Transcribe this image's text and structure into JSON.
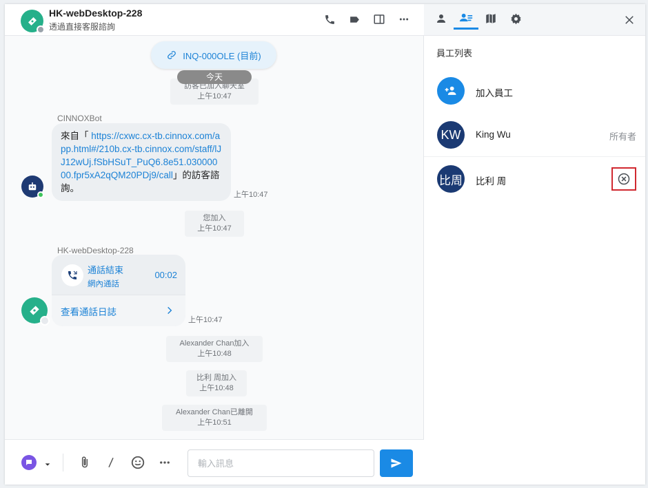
{
  "header": {
    "title": "HK-webDesktop-228",
    "subtitle": "透過直接客服諮詢"
  },
  "messages": {
    "inquiry_pill": "INQ-000OLE (目前)",
    "today": "今天",
    "sys1_line1": "訪客已加入聊天室",
    "sys1_line2": "上午10:47",
    "bot_sender": "CINNOXBot",
    "bot_prefix": "來自「 ",
    "bot_link": "https://cxwc.cx-tb.cinnox.com/app.html#/210b.cx-tb.cinnox.com/staff/lJJ12wUj.fSbHSuT_PuQ6.8e51.03000000.fpr5xA2qQM20PDj9/call",
    "bot_suffix": "」的訪客諮詢。",
    "bot_time": "上午10:47",
    "sys2_line1": "您加入",
    "sys2_line2": "上午10:47",
    "call_sender": "HK-webDesktop-228",
    "call_title": "通話結束",
    "call_sub": "網內通話",
    "call_duration": "00:02",
    "call_log_label": "查看通話日誌",
    "call_time": "上午10:47",
    "sys3_line1": "Alexander Chan加入",
    "sys3_line2": "上午10:48",
    "sys4_line1": "比利 周加入",
    "sys4_line2": "上午10:48",
    "sys5_line1": "Alexander Chan已離開",
    "sys5_line2": "上午10:51"
  },
  "composer": {
    "placeholder": "輸入訊息"
  },
  "side": {
    "title": "員工列表",
    "add_label": "加入員工",
    "members": [
      {
        "initials": "KW",
        "name": "King Wu",
        "role": "所有者",
        "color": "#1b3a73"
      },
      {
        "initials": "比周",
        "name": "比利 周",
        "role": "",
        "color": "#1b3a73"
      }
    ]
  },
  "colors": {
    "accent": "#1a8ae5",
    "visitor_green": "#26b08a",
    "remove_highlight": "#d0282f"
  }
}
